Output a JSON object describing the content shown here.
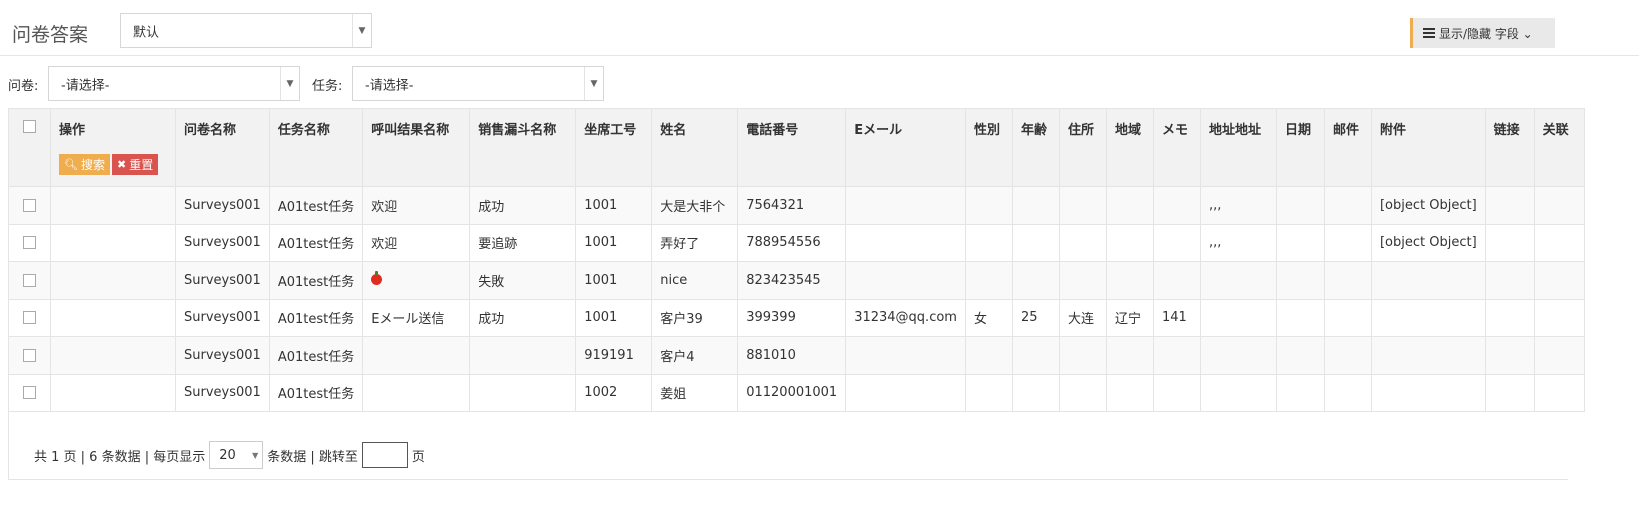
{
  "page_title": "问卷答案",
  "top_select": {
    "value": "默认"
  },
  "toggle_fields_label": "显示/隐藏 字段 ⌄",
  "filters": {
    "survey_label": "问卷:",
    "survey_value": "-请选择-",
    "task_label": "任务:",
    "task_value": "-请选择-"
  },
  "table": {
    "op_header": "操作",
    "search_label": "搜索",
    "reset_label": "重置",
    "columns": [
      "问卷名称",
      "任务名称",
      "呼叫结果名称",
      "销售漏斗名称",
      "坐席工号",
      "姓名",
      "電話番号",
      "Eメール",
      "性別",
      "年齢",
      "住所",
      "地域",
      "メモ",
      "地址地址",
      "日期",
      "邮件",
      "附件",
      "链接",
      "关联"
    ],
    "rows": [
      [
        "Surveys001",
        "A01test任务",
        "欢迎",
        "成功",
        "1001",
        "大是大非个",
        "7564321",
        "",
        "",
        "",
        "",
        "",
        "",
        ",,,",
        "",
        "",
        "[object Object]",
        "",
        ""
      ],
      [
        "Surveys001",
        "A01test任务",
        "欢迎",
        "要追跡",
        "1001",
        "弄好了",
        "788954556",
        "",
        "",
        "",
        "",
        "",
        "",
        ",,,",
        "",
        "",
        "[object Object]",
        "",
        ""
      ],
      [
        "Surveys001",
        "A01test任务",
        "",
        "失敗",
        "1001",
        "nice",
        "823423545",
        "",
        "",
        "",
        "",
        "",
        "",
        "",
        "",
        "",
        "",
        "",
        ""
      ],
      [
        "Surveys001",
        "A01test任务",
        "Eメール送信",
        "成功",
        "1001",
        "客户39",
        "399399",
        "31234@qq.com",
        "女",
        "25",
        "大连",
        "辽宁",
        "141",
        "",
        "",
        "",
        "",
        "",
        ""
      ],
      [
        "Surveys001",
        "A01test任务",
        "",
        "",
        "919191",
        "客户4",
        "881010",
        "",
        "",
        "",
        "",
        "",
        "",
        "",
        "",
        "",
        "",
        "",
        ""
      ],
      [
        "Surveys001",
        "A01test任务",
        "",
        "",
        "1002",
        "姜姐",
        "01120001001",
        "",
        "",
        "",
        "",
        "",
        "",
        "",
        "",
        "",
        "",
        "",
        ""
      ]
    ],
    "row3_icon": "apple-icon"
  },
  "pager": {
    "summary": "共 1 页 | 6 条数据 | 每页显示",
    "page_size": "20",
    "after_size": "条数据 | 跳转至",
    "page_suffix": "页"
  },
  "colors": {
    "accent_orange": "#f0ad4e",
    "danger_red": "#d9534f",
    "header_bg": "#f2f2f2"
  }
}
